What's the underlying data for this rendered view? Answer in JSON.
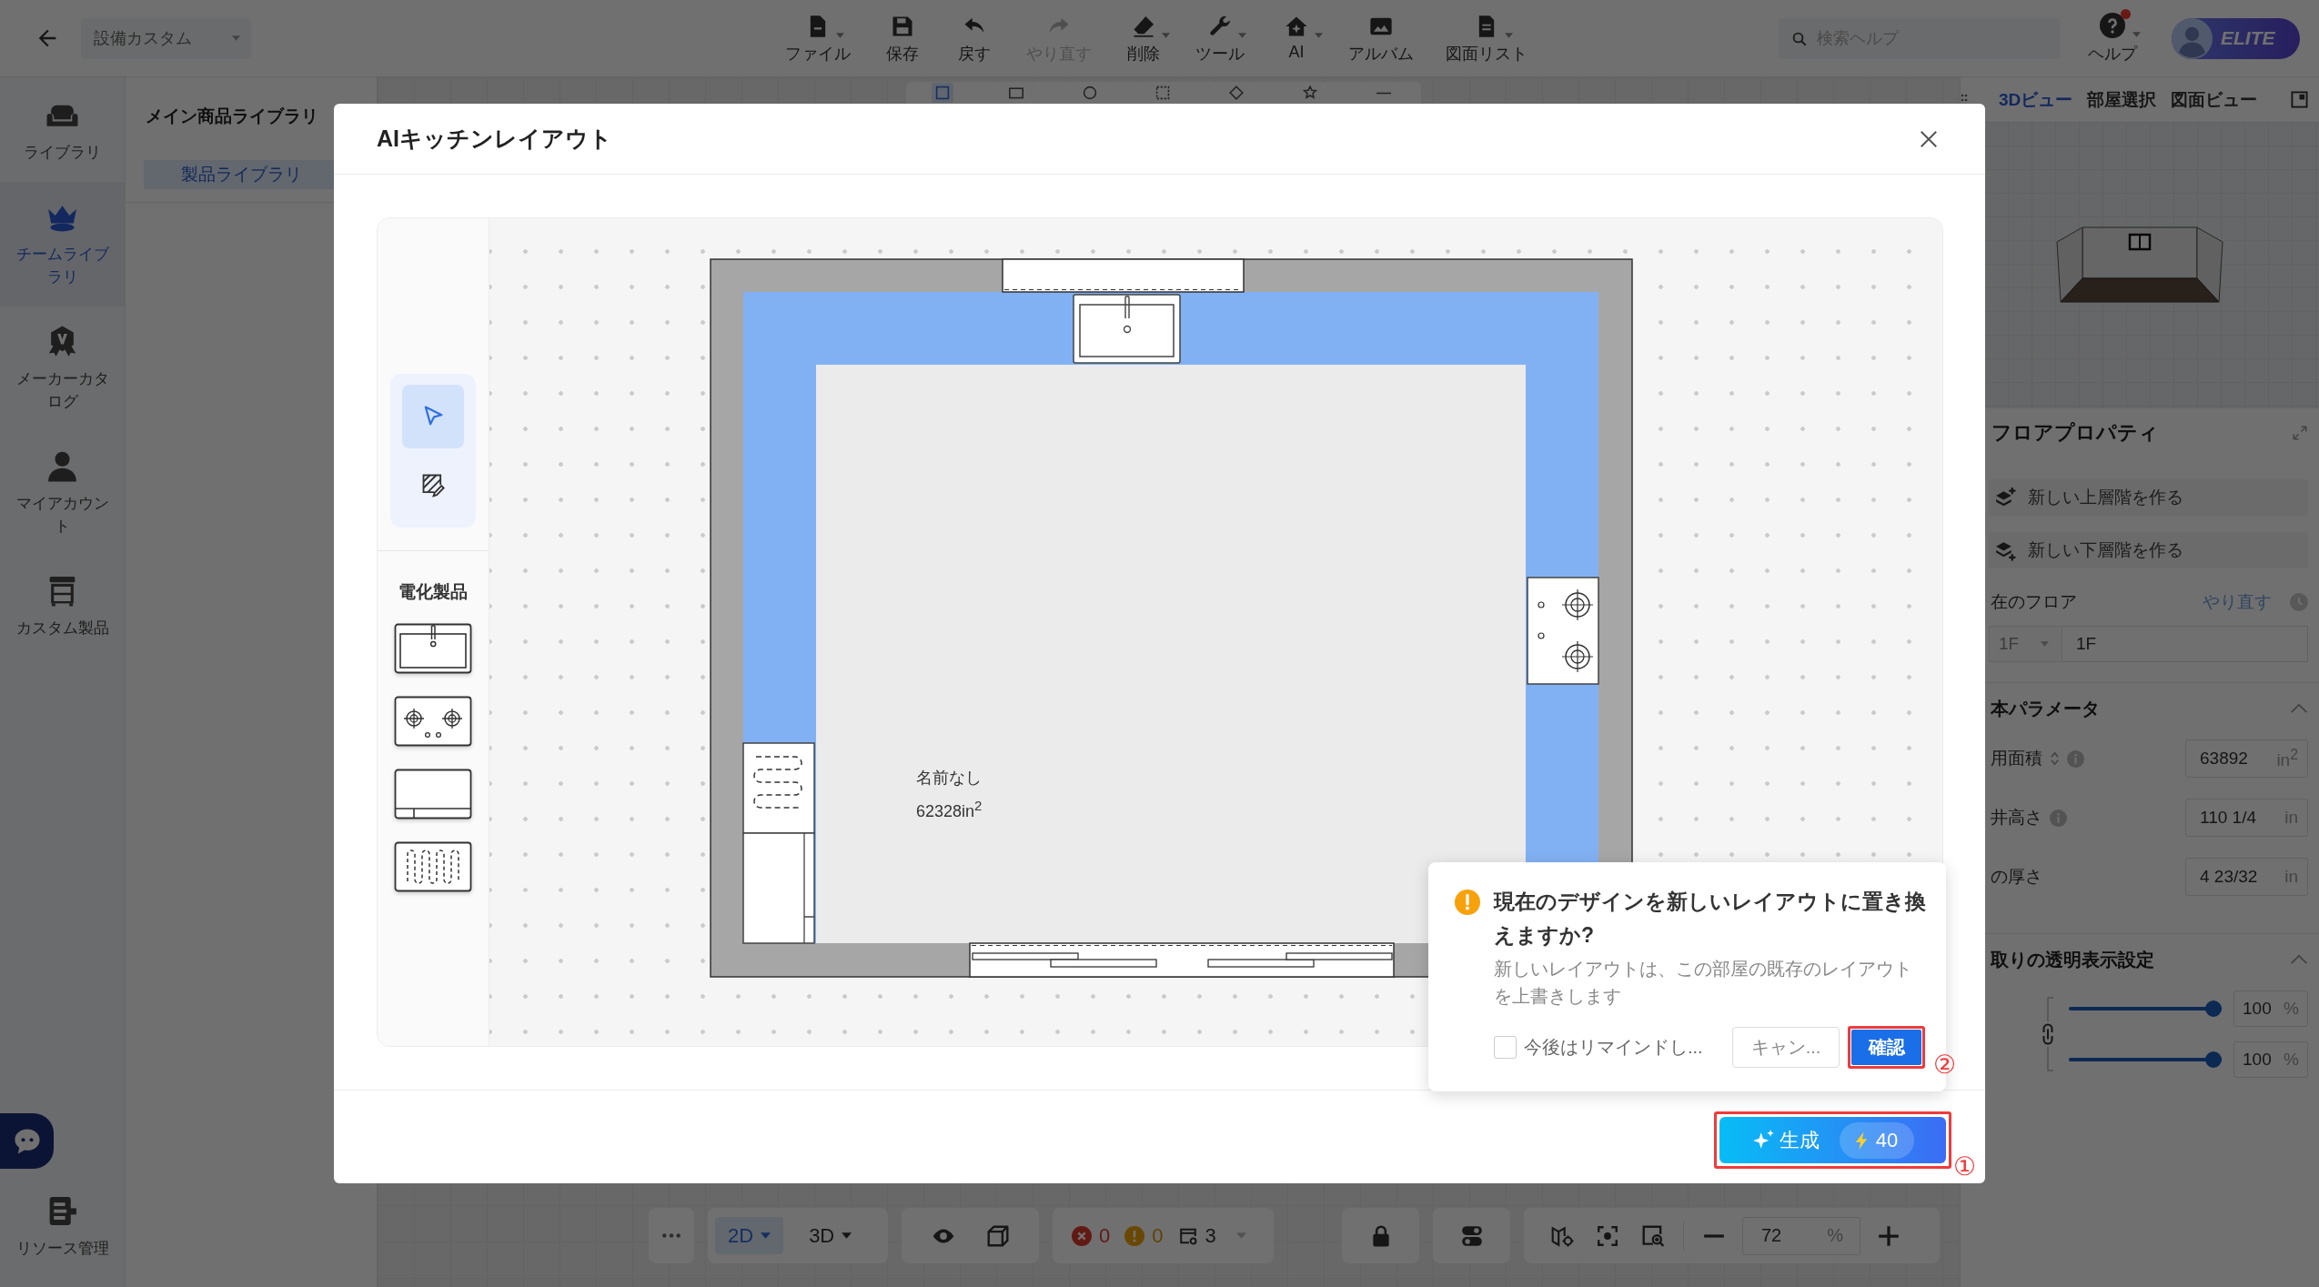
{
  "top_bar": {
    "project": "設備カスタム",
    "tools": [
      {
        "label": "ファイル",
        "dropdown": true,
        "disabled": false
      },
      {
        "label": "保存",
        "dropdown": false,
        "disabled": false
      },
      {
        "label": "戻す",
        "dropdown": false,
        "disabled": false
      },
      {
        "label": "やり直す",
        "dropdown": false,
        "disabled": true
      },
      {
        "label": "削除",
        "dropdown": true,
        "disabled": false
      },
      {
        "label": "ツール",
        "dropdown": true,
        "disabled": false
      },
      {
        "label": "AI",
        "dropdown": true,
        "disabled": false
      },
      {
        "label": "アルバム",
        "dropdown": false,
        "disabled": false
      },
      {
        "label": "図面リスト",
        "dropdown": true,
        "disabled": false
      }
    ],
    "search": {
      "placeholder": "検索ヘルプ"
    },
    "help": {
      "label": "ヘルプ",
      "notification": true
    },
    "plan_badge": "ELITE"
  },
  "sidebar": {
    "items": [
      {
        "label": "ライブラリ",
        "selected": false
      },
      {
        "label": "チームライブラリ",
        "selected": true
      },
      {
        "label": "メーカーカタログ",
        "selected": false
      },
      {
        "label": "マイアカウント",
        "selected": false
      },
      {
        "label": "カスタム製品",
        "selected": false
      }
    ],
    "footer_item": {
      "label": "リソース管理",
      "selected": false
    }
  },
  "library_panel": {
    "title": "メイン商品ライブラリ",
    "tabs": [
      {
        "label": "製品ライブラリ",
        "selected": true
      }
    ]
  },
  "canvas_toolbar": {
    "tools": [
      {
        "selected": true
      },
      {
        "selected": false
      },
      {
        "selected": false
      },
      {
        "selected": false
      },
      {
        "selected": false
      },
      {
        "selected": false
      },
      {
        "selected": false
      }
    ]
  },
  "bottom_bar": {
    "view_modes": [
      {
        "label": "2D",
        "selected": true
      },
      {
        "label": "3D",
        "selected": false
      }
    ],
    "errors": "0",
    "warnings": "0",
    "layers": "3",
    "zoom": {
      "value": "72",
      "unit": "%"
    }
  },
  "right_panel": {
    "tabs": [
      {
        "label": "3Dビュー",
        "selected": true
      },
      {
        "label": "部屋選択",
        "selected": false
      },
      {
        "label": "図面ビュー",
        "selected": false
      }
    ],
    "title": "フロアプロパティ",
    "floor_actions": [
      {
        "label": "新しい上層階を作る",
        "kind": "up"
      },
      {
        "label": "新しい下層階を作る",
        "kind": "down"
      }
    ],
    "current_floor": {
      "label": "在のフロア",
      "link": "やり直す",
      "select": "1F",
      "value": "1F"
    },
    "parameters": {
      "title": "本パラメータ",
      "expanded": true,
      "rows": [
        {
          "label": "用面積",
          "sortable": true,
          "info": true,
          "value": "63892",
          "unit": "in$^{2}$"
        },
        {
          "label": "井高さ",
          "sortable": false,
          "info": true,
          "value": "110 1/4",
          "unit": "in"
        },
        {
          "label": "の厚さ",
          "sortable": false,
          "info": false,
          "value": "4 23/32",
          "unit": "in"
        }
      ]
    },
    "transparency": {
      "title": "取りの透明表示設定",
      "expanded": true,
      "sliders": [
        {
          "level": 1,
          "value": "100",
          "unit": "%"
        },
        {
          "level": 1,
          "value": "100",
          "unit": "%"
        }
      ]
    }
  },
  "dialog": {
    "title": "AIキッチンレイアウト",
    "tools": [
      {
        "selected": true
      },
      {
        "selected": false
      }
    ],
    "palette": {
      "title": "電化製品",
      "items": [
        {
          "kind": "sink"
        },
        {
          "kind": "cooktop"
        },
        {
          "kind": "oven"
        },
        {
          "kind": "radiator"
        }
      ]
    },
    "plan": {
      "room_name": "名前なし",
      "room_area": "62328in$^{2}$",
      "fixtures": [
        {
          "kind": "window"
        },
        {
          "kind": "sink"
        },
        {
          "kind": "cooktop"
        },
        {
          "kind": "heater"
        },
        {
          "kind": "cabinet"
        },
        {
          "kind": "door"
        }
      ]
    },
    "confirm": {
      "title": "現在のデザインを新しいレイアウトに置き換えますか?",
      "message": "新しいレイアウトは、この部屋の既存のレイアウトを上書きします",
      "dont_remind": {
        "label": "今後はリマインドし...",
        "checked": false
      },
      "cancel": "キャン...",
      "ok": {
        "label": "確認",
        "annotation": "②"
      }
    },
    "generate": {
      "label": "生成",
      "cost": "40",
      "annotation": "①"
    }
  }
}
